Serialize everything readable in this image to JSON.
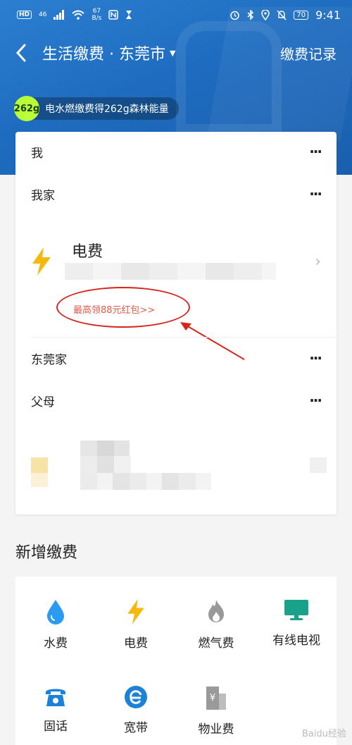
{
  "status": {
    "hd": "HD",
    "network": "46",
    "speed_value": "67",
    "speed_unit": "B/s",
    "battery": "70",
    "time": "9:41"
  },
  "nav": {
    "title": "生活缴费 · 东莞市",
    "record": "缴费记录"
  },
  "energy": {
    "badge": "262g",
    "text": "电水燃缴费得262g森林能量"
  },
  "groups": [
    {
      "name": "我"
    },
    {
      "name": "我家"
    },
    {
      "name": "东莞家"
    },
    {
      "name": "父母"
    }
  ],
  "electric": {
    "title": "电费",
    "promo": "最高领88元红包>>"
  },
  "colors": {
    "accent": "#1e6cc0",
    "promo": "#e05a4a",
    "annotation": "#d8241c",
    "water": "#2b9af3",
    "power": "#f5b90b",
    "gas": "#999999",
    "tv": "#1aa18a"
  },
  "new_payment": {
    "title": "新增缴费",
    "items": [
      {
        "label": "水费",
        "icon": "water-drop-icon"
      },
      {
        "label": "电费",
        "icon": "lightning-icon"
      },
      {
        "label": "燃气费",
        "icon": "flame-icon"
      },
      {
        "label": "有线电视",
        "icon": "tv-icon"
      },
      {
        "label": "固话",
        "icon": "telephone-icon"
      },
      {
        "label": "宽带",
        "icon": "broadband-icon"
      },
      {
        "label": "物业费",
        "icon": "building-icon"
      }
    ]
  },
  "watermark": "Baidu经验"
}
